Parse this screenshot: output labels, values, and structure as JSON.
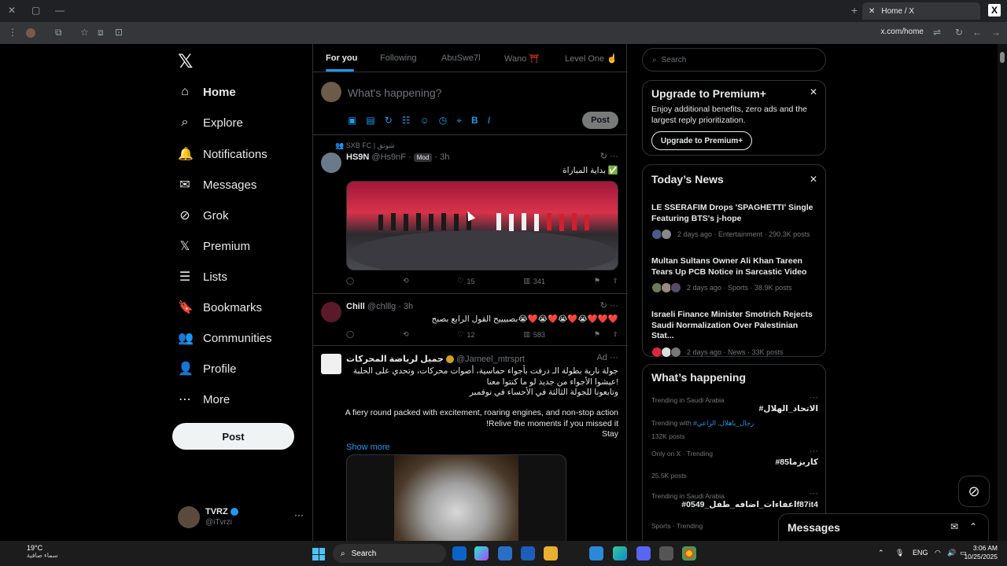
{
  "browser": {
    "tab_title": "Home / X",
    "tab_close": "✕",
    "new_tab": "+",
    "url": "x.com/home"
  },
  "sidebar": {
    "logo": "𝕏",
    "items": [
      {
        "label": "Home",
        "icon": "home-icon",
        "glyph": "⌂"
      },
      {
        "label": "Explore",
        "icon": "search-icon",
        "glyph": "⌕"
      },
      {
        "label": "Notifications",
        "icon": "bell-icon",
        "glyph": "🔔"
      },
      {
        "label": "Messages",
        "icon": "mail-icon",
        "glyph": "✉"
      },
      {
        "label": "Grok",
        "icon": "grok-icon",
        "glyph": "⊘"
      },
      {
        "label": "Premium",
        "icon": "x-icon",
        "glyph": "𝕏"
      },
      {
        "label": "Lists",
        "icon": "list-icon",
        "glyph": "☰"
      },
      {
        "label": "Bookmarks",
        "icon": "bookmark-icon",
        "glyph": "🔖"
      },
      {
        "label": "Communities",
        "icon": "people-icon",
        "glyph": "👥"
      },
      {
        "label": "Profile",
        "icon": "person-icon",
        "glyph": "👤"
      },
      {
        "label": "More",
        "icon": "more-icon",
        "glyph": "⋯"
      }
    ],
    "post_label": "Post",
    "account": {
      "name": "TVRZ",
      "handle": "@iTvrzi",
      "more": "···"
    }
  },
  "main": {
    "tabs": [
      "For you",
      "Following",
      "AbuSwe7l",
      "Wano ⛩️",
      "Level One ☝️"
    ],
    "compose": {
      "placeholder": "What's happening?",
      "tools": [
        "▣",
        "▤",
        "↻",
        "☷",
        "☺",
        "◷",
        "⌖",
        "B",
        "I"
      ],
      "post_label": "Post"
    },
    "tweets": [
      {
        "social_context": "SXB FC | شوتق",
        "name": "HS9N",
        "handle": "@Hs9nF",
        "badge": "Mod",
        "time": "3h",
        "text": "بداية المباراة ✅",
        "replies": "",
        "retweets": "",
        "likes": "15",
        "views": "341"
      },
      {
        "name": "Chill",
        "handle": "@chlllg",
        "time": "3h",
        "text": "بصبيييح القول الرابع بصبح😭❤️😭❤️😭❤️😭❤️❤️❤️",
        "replies": "",
        "retweets": "",
        "likes": "12",
        "views": "583"
      },
      {
        "name": "جميل لرياضة المحركات",
        "handle": "@Jameel_mtrsprt",
        "ad": "Ad",
        "text_ar_1": "جولة نارية بطولة الـ درفت بأجواء حماسية، أصوات محركات، وتحدي على الحلبة",
        "text_ar_2": "عيشوا الأجواء من جديد لو ما كنتوا معنا!",
        "text_ar_3": "وتابعونا للجولة الثالثة في الأحساء في نوفمبر",
        "text_en_1": "A fiery round packed with excitement, roaring engines, and non-stop action",
        "text_en_2": "!Relive the moments if you missed it",
        "text_en_3": "Stay",
        "show_more": "Show more"
      }
    ]
  },
  "right": {
    "search_placeholder": "Search",
    "premium": {
      "title": "Upgrade to Premium+",
      "desc": "Enjoy additional benefits, zero ads and the largest reply prioritization.",
      "button": "Upgrade to Premium+"
    },
    "news": {
      "title": "Today’s News",
      "items": [
        {
          "headline": "LE SSERAFIM Drops 'SPAGHETTI' Single Featuring BTS's j-hope",
          "meta": "2 days ago · Entertainment · 290.3K posts"
        },
        {
          "headline": "Multan Sultans Owner Ali Khan Tareen Tears Up PCB Notice in Sarcastic Video",
          "meta": "2 days ago · Sports · 38.9K posts"
        },
        {
          "headline": "Israeli Finance Minister Smotrich Rejects Saudi Normalization Over Palestinian Stat...",
          "meta": "2 days ago · News · 33K posts"
        }
      ]
    },
    "happening": {
      "title": "What’s happening",
      "items": [
        {
          "context": "Trending in Saudi Arabia",
          "tag": "#الاتحاد_الهلال",
          "sub_prefix": "Trending with ",
          "sub_link": "#رجال_ياهلال, الزاعي",
          "posts": "132K posts"
        },
        {
          "context": "Only on X · Trending",
          "tag": "#كاربزما85",
          "posts": "25.5K posts"
        },
        {
          "context": "Trending in Saudi Arabia",
          "tag": "#اعفاءات_اضافه_طفل_0549f87it4",
          "posts": ""
        },
        {
          "context": "Sports · Trending",
          "tag": "",
          "posts": ""
        }
      ]
    }
  },
  "messages_drawer": {
    "title": "Messages"
  },
  "taskbar": {
    "weather_temp": "19°C",
    "weather_desc": "سماء صافية",
    "search": "Search",
    "lang": "ENG",
    "time": "3:06 AM",
    "date": "10/25/2025"
  }
}
